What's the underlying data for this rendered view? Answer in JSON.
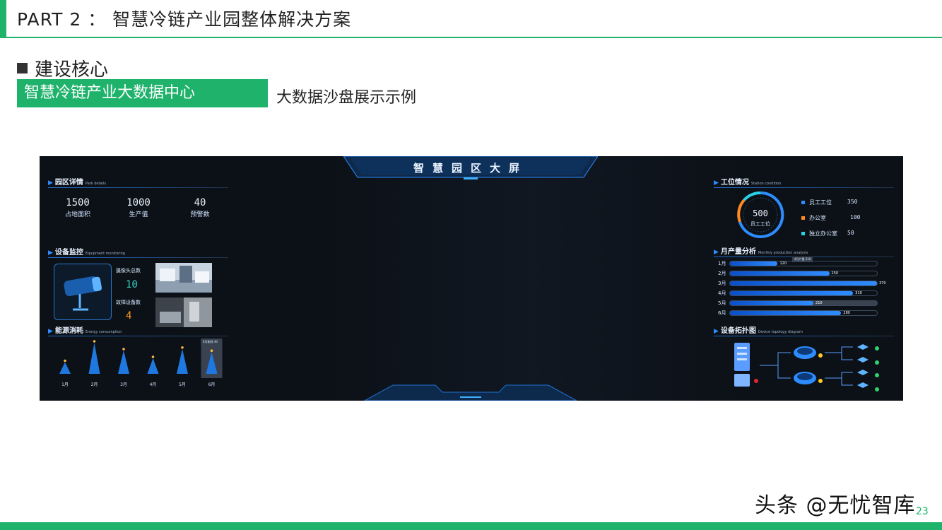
{
  "slide": {
    "header_title": "PART 2 ： 智慧冷链产业园整体解决方案",
    "section_title": "建设核心",
    "tag_label": "智慧冷链产业大数据中心",
    "subtitle": "大数据沙盘展示示例",
    "watermark": "头条 @无忧智库",
    "page_number": "23"
  },
  "dashboard": {
    "title": "智慧园区大屏",
    "park": {
      "title": "园区详情",
      "title_en": "Park details",
      "stats": [
        {
          "value": "1500",
          "label": "占地面积"
        },
        {
          "value": "1000",
          "label": "生产值"
        },
        {
          "value": "40",
          "label": "预警数"
        }
      ]
    },
    "equipment": {
      "title": "设备监控",
      "title_en": "Equipment monitoring",
      "camera_label": "摄像头总数",
      "camera_value": "10",
      "fault_label": "故障设备数",
      "fault_value": "4"
    },
    "energy": {
      "title": "能源消耗",
      "title_en": "Energy consumption",
      "tooltip": "6月能耗 40"
    },
    "station": {
      "title": "工位情况",
      "title_en": "Station condition",
      "total_value": "500",
      "total_label": "员工工位",
      "items": [
        {
          "label": "员工工位",
          "value": "350",
          "color": "#2d8cff"
        },
        {
          "label": "办公室",
          "value": "100",
          "color": "#ff8a1f"
        },
        {
          "label": "独立办公室",
          "value": "50",
          "color": "#27d3e8"
        }
      ]
    },
    "production": {
      "title": "月产量分析",
      "title_en": "Monthly production analysis",
      "tooltip": "4月产量 310"
    },
    "topology": {
      "title": "设备拓扑图",
      "title_en": "Device topology diagram"
    }
  },
  "chart_data": [
    {
      "type": "bar",
      "chart": "energy",
      "categories": [
        "1月",
        "2月",
        "3月",
        "4月",
        "5月",
        "6月"
      ],
      "values": [
        15,
        40,
        30,
        20,
        32,
        28
      ]
    },
    {
      "type": "bar",
      "chart": "production",
      "orientation": "horizontal",
      "categories": [
        "1月",
        "2月",
        "3月",
        "4月",
        "5月",
        "6月"
      ],
      "values": [
        120,
        250,
        370,
        310,
        210,
        280
      ],
      "xlim": [
        0,
        370
      ]
    }
  ]
}
